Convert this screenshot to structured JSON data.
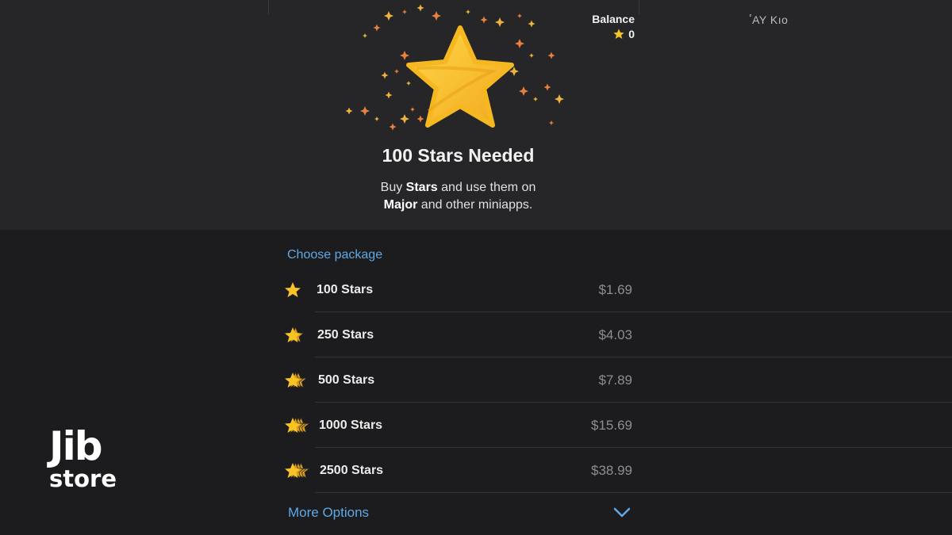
{
  "header": {
    "title": "100 Stars Needed",
    "subtitle_part1": "Buy ",
    "subtitle_bold1": "Stars",
    "subtitle_part2": " and use them on",
    "subtitle_bold2": "Major",
    "subtitle_part3": " and other miniapps."
  },
  "balance": {
    "label": "Balance",
    "value": "0",
    "icon": "star-icon"
  },
  "corner_text": "ٴAY Kıo",
  "packages": {
    "section_title": "Choose package",
    "items": [
      {
        "label": "100 Stars",
        "price": "$1.69",
        "icon": "single-star-icon"
      },
      {
        "label": "250 Stars",
        "price": "$4.03",
        "icon": "double-star-icon"
      },
      {
        "label": "500 Stars",
        "price": "$7.89",
        "icon": "triple-star-icon"
      },
      {
        "label": "1000 Stars",
        "price": "$15.69",
        "icon": "stacked-stars-icon"
      },
      {
        "label": "2500 Stars",
        "price": "$38.99",
        "icon": "stacked-stars-icon"
      }
    ],
    "more_label": "More Options",
    "more_icon": "chevron-down-icon"
  },
  "watermark": {
    "line1": "Jib",
    "line2": "store"
  },
  "colors": {
    "accent": "#5fa9e6",
    "star": "#f7c325",
    "background": "#1c1c1e",
    "header_bg": "#262628"
  }
}
